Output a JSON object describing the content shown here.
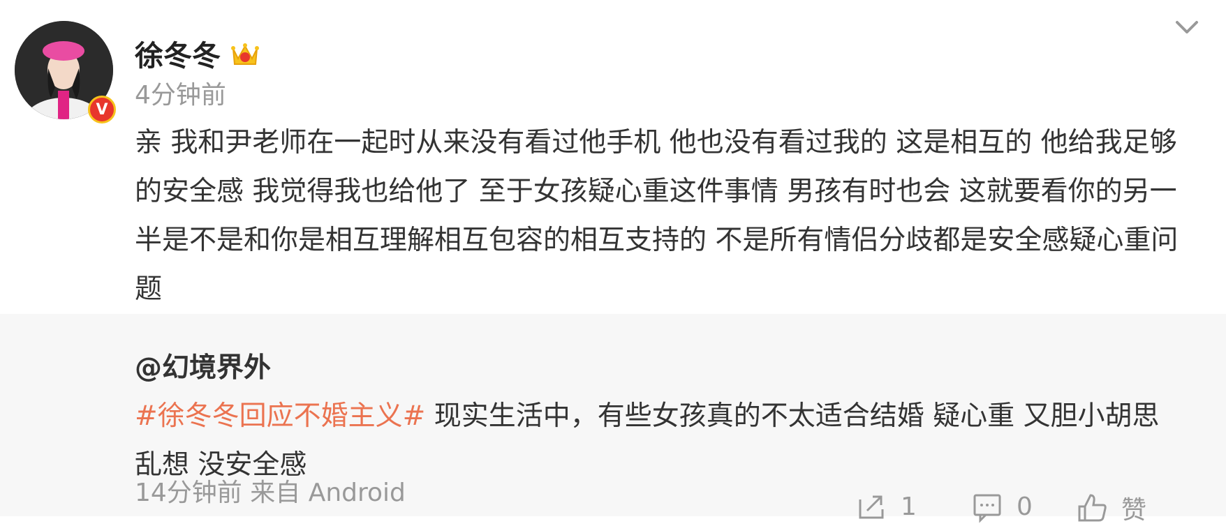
{
  "post": {
    "username": "徐冬冬",
    "time": "4分钟前",
    "text": "亲 我和尹老师在一起时从来没有看过他手机 他也没有看过我的 这是相互的 他给我足够的安全感 我觉得我也给他了 至于女孩疑心重这件事情 男孩有时也会 这就要看你的另一半是不是和你是相互理解相互包容的相互支持的 不是所有情侣分歧都是安全感疑心重问题",
    "badge_letter": "V"
  },
  "quoted": {
    "author": "@幻境界外",
    "hashtag": "#徐冬冬回应不婚主义#",
    "text": " 现实生活中，有些女孩真的不太适合结婚 疑心重 又胆小胡思乱想 没安全感",
    "meta": "14分钟前  来自 Android",
    "actions": {
      "repost_count": "1",
      "comment_count": "0",
      "like_label": "赞"
    }
  },
  "colors": {
    "hashtag": "#eb7350",
    "badge": "#e8362c"
  }
}
